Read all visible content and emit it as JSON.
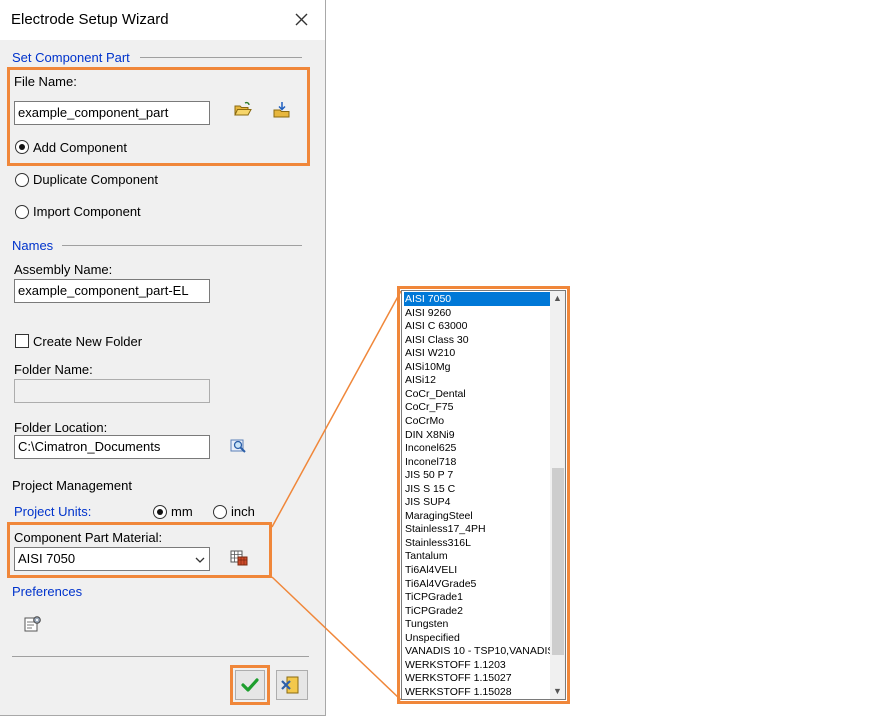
{
  "window": {
    "title": "Electrode Setup Wizard"
  },
  "sections": {
    "set_component_part": "Set Component Part",
    "names": "Names",
    "project_management": "Project Management",
    "preferences": "Preferences"
  },
  "file": {
    "label": "File Name:",
    "value": "example_component_part",
    "open_icon": "folder-open-icon",
    "import_icon": "import-icon"
  },
  "component_mode": {
    "options": [
      "Add Component",
      "Duplicate Component",
      "Import Component"
    ],
    "selected": "Add Component"
  },
  "names": {
    "assembly_label": "Assembly Name:",
    "assembly_value": "example_component_part-EL",
    "create_folder_label": "Create New Folder",
    "create_folder_checked": false,
    "folder_name_label": "Folder Name:",
    "folder_name_value": "",
    "folder_location_label": "Folder Location:",
    "folder_location_value": "C:\\Cimatron_Documents"
  },
  "project": {
    "units_label": "Project Units:",
    "unit_mm": "mm",
    "unit_inch": "inch",
    "selected_unit": "mm",
    "material_label": "Component Part Material:",
    "material_value": "AISI 7050"
  },
  "materials_list": {
    "selected": "AISI 7050",
    "items": [
      "AISI 7050",
      "AISI 9260",
      "AISI C 63000",
      "AISI Class 30",
      "AISI W210",
      "AISi10Mg",
      "AISi12",
      "CoCr_Dental",
      "CoCr_F75",
      "CoCrMo",
      "DIN X8Ni9",
      "Inconel625",
      "Inconel718",
      "JIS 50 P 7",
      "JIS S 15 C",
      "JIS SUP4",
      "MaragingSteel",
      "Stainless17_4PH",
      "Stainless316L",
      "Tantalum",
      "Ti6Al4VELI",
      "Ti6Al4VGrade5",
      "TiCPGrade1",
      "TiCPGrade2",
      "Tungsten",
      "Unspecified",
      "VANADIS 10 - TSP10,VANADIS",
      "WERKSTOFF 1.1203",
      "WERKSTOFF 1.15027",
      "WERKSTOFF 1.15028"
    ]
  },
  "colors": {
    "highlight": "#f0873a",
    "section_blue": "#0033cc",
    "selection": "#0078d7",
    "ok_green": "#1e9e2e"
  }
}
